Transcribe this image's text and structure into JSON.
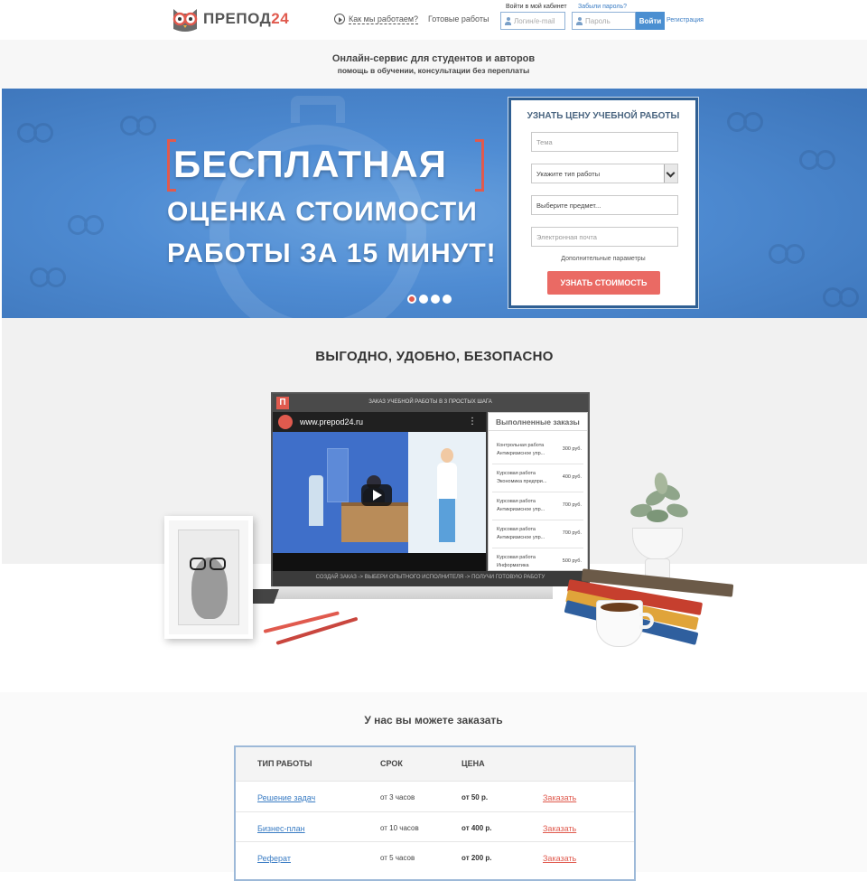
{
  "header": {
    "logo_text": "ПРЕПОД",
    "logo_num": "24",
    "how_we_work": "Как мы работаем?",
    "ready_works": "Готовые работы",
    "login_label": "Войти в мой кабинет",
    "forgot_label": "Забыли пароль?",
    "login_placeholder": "Логин/e-mail",
    "password_placeholder": "Пароль",
    "login_button": "Войти",
    "register": "Регистрация"
  },
  "tagline": {
    "line1": "Онлайн-сервис для студентов и авторов",
    "line2": "помощь в обучении, консультации без переплаты"
  },
  "hero": {
    "line1": "БЕСПЛАТНАЯ",
    "line2": "ОЦЕНКА СТОИМОСТИ",
    "line3": "РАБОТЫ ЗА 15 МИНУТ!",
    "slide_count": 4,
    "active_slide": 1
  },
  "price_form": {
    "title": "УЗНАТЬ ЦЕНУ УЧЕБНОЙ РАБОТЫ",
    "topic_placeholder": "Тема",
    "type_selected": "Укажите тип работы",
    "subject_placeholder": "Выберите предмет...",
    "email_placeholder": "Электронная почта",
    "extra_params": "Дополнительные параметры",
    "submit": "УЗНАТЬ СТОИМОСТЬ"
  },
  "benefits": {
    "title": "ВЫГОДНО, УДОБНО, БЕЗОПАСНО",
    "monitor_logo": "П",
    "monitor_title": "ЗАКАЗ УЧЕБНОЙ РАБОТЫ В 3 ПРОСТЫХ ШАГА",
    "video_url": "www.prepod24.ru",
    "video_menu": "⋮",
    "orders_title": "Выполненные заказы",
    "orders": [
      {
        "type": "Контрольная работа",
        "subject": "Антикризисное упр...",
        "price": "300 руб."
      },
      {
        "type": "Курсовая работа",
        "subject": "Экономика предпри...",
        "price": "400 руб."
      },
      {
        "type": "Курсовая работа",
        "subject": "Антикризисное упр...",
        "price": "700 руб."
      },
      {
        "type": "Курсовая работа",
        "subject": "Антикризисное упр...",
        "price": "700 руб."
      },
      {
        "type": "Курсовая работа",
        "subject": "Информатика",
        "price": "500 руб."
      }
    ],
    "steps": "СОЗДАЙ ЗАКАЗ -> ВЫБЕРИ ОПЫТНОГО ИСПОЛНИТЕЛЯ -> ПОЛУЧИ ГОТОВУЮ РАБОТУ"
  },
  "order_section": {
    "title": "У нас вы можете заказать",
    "headers": {
      "type": "ТИП РАБОТЫ",
      "term": "СРОК",
      "price": "ЦЕНА"
    },
    "rows": [
      {
        "type": "Решение задач",
        "term": "от 3 часов",
        "price": "от 50 р.",
        "action": "Заказать"
      },
      {
        "type": "Бизнес-план",
        "term": "от 10 часов",
        "price": "от 400 р.",
        "action": "Заказать"
      },
      {
        "type": "Реферат",
        "term": "от 5 часов",
        "price": "от 200 р.",
        "action": "Заказать"
      }
    ]
  },
  "colors": {
    "brand_red": "#e05a4e",
    "hero_blue": "#4f8cd3",
    "link_blue": "#3b7dc4"
  }
}
